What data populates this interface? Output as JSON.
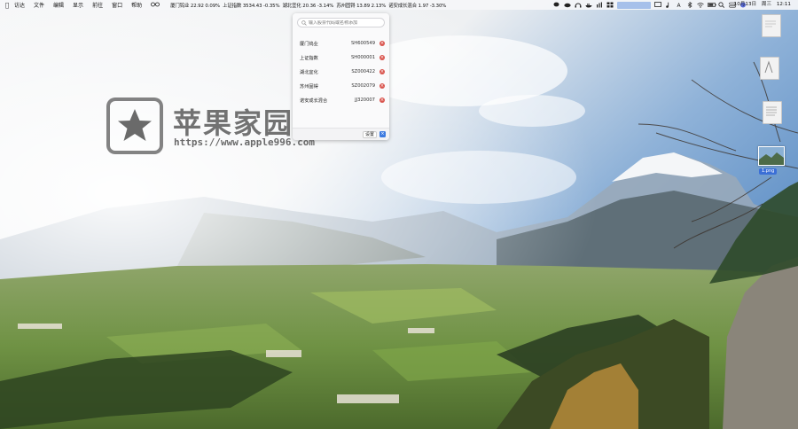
{
  "menubar": {
    "apple_icon": "apple-logo-icon",
    "menus": [
      "访达",
      "文件",
      "编辑",
      "显示",
      "前往",
      "窗口",
      "帮助"
    ],
    "tickers": [
      "厦门钨业 22.92 0.09%",
      "上证指数 3534.43 -0.35%",
      "湖北宜化 20.36 -3.14%",
      "苏州固锝 13.89 2.13%",
      "诺安成长混合 1.97 -3.30%"
    ],
    "clock": {
      "date": "10月13日",
      "weekday": "周三",
      "time": "12:11"
    }
  },
  "stock_panel": {
    "search_placeholder": "输入股票代码或名称添加",
    "stocks": [
      {
        "name": "厦门钨业",
        "code": "SH600549"
      },
      {
        "name": "上证指数",
        "code": "SH000001"
      },
      {
        "name": "湖北宜化",
        "code": "SZ000422"
      },
      {
        "name": "苏州固锝",
        "code": "SZ002079"
      },
      {
        "name": "诺安成长混合",
        "code": "JJ320007"
      }
    ],
    "settings_label": "设置",
    "delete_symbol": "×",
    "close_symbol": "×"
  },
  "watermark": {
    "brand": "苹果家园",
    "url": "https://www.apple996.com"
  },
  "desktop": {
    "image_file_label": "1.png"
  },
  "colors": {
    "delete_red": "#d9544d",
    "accent_blue": "#3d7be0",
    "selection_blue": "#3b6fd6"
  }
}
